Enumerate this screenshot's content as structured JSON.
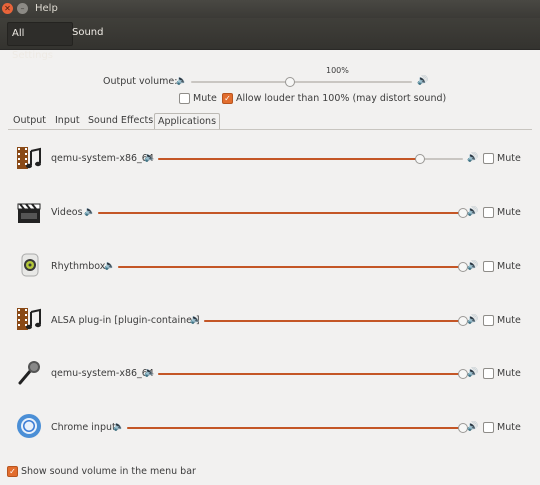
{
  "window": {
    "title": "Help"
  },
  "nav": {
    "all_settings": "All Settings",
    "sound": "Sound"
  },
  "output": {
    "volume_label": "Output volume:",
    "scale_marker": "100%",
    "volume_fraction": 0.45,
    "mute_label": "Mute",
    "mute_checked": false,
    "allow_louder_label": "Allow louder than 100% (may distort sound)",
    "allow_louder_checked": true
  },
  "tabs": [
    "Output",
    "Input",
    "Sound Effects",
    "Applications"
  ],
  "active_tab": "Applications",
  "apps": [
    {
      "name": "qemu-system-x86_64",
      "icon": "film-music-icon",
      "volume_fraction": 0.86,
      "mute_label": "Mute",
      "muted": false
    },
    {
      "name": "Videos",
      "icon": "clapperboard-icon",
      "volume_fraction": 1.0,
      "mute_label": "Mute",
      "muted": false
    },
    {
      "name": "Rhythmbox",
      "icon": "speaker-icon",
      "volume_fraction": 1.0,
      "mute_label": "Mute",
      "muted": false
    },
    {
      "name": "ALSA plug-in [plugin-container]",
      "icon": "film-music-icon",
      "volume_fraction": 1.0,
      "mute_label": "Mute",
      "muted": false
    },
    {
      "name": "qemu-system-x86_64",
      "icon": "microphone-icon",
      "volume_fraction": 1.0,
      "mute_label": "Mute",
      "muted": false
    },
    {
      "name": "Chrome input",
      "icon": "chrome-icon",
      "volume_fraction": 1.0,
      "mute_label": "Mute",
      "muted": false
    }
  ],
  "footer": {
    "show_in_menu_bar_label": "Show sound volume in the menu bar",
    "checked": true
  },
  "colors": {
    "accent": "#e26d2e",
    "slider_fill": "#c45626",
    "titlebar": "#3c3b37",
    "background": "#f2f1f0"
  }
}
